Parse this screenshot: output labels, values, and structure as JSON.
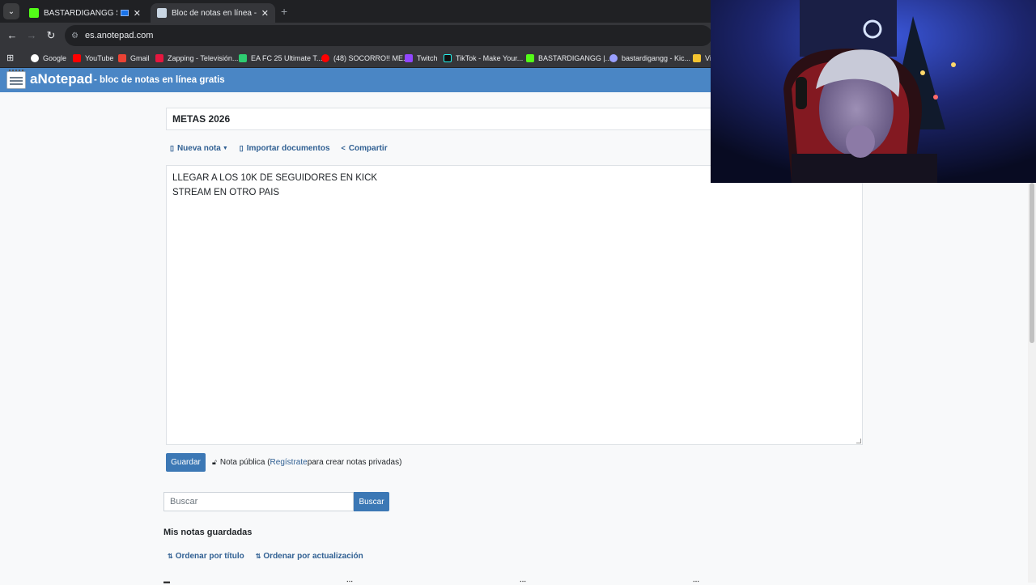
{
  "browser": {
    "tabs": [
      {
        "title": "BASTARDIGANGG Stream -",
        "active": false
      },
      {
        "title": "Bloc de notas en línea - Toma y",
        "active": true
      }
    ],
    "address": "es.anotepad.com",
    "bookmarks": [
      {
        "label": "Google"
      },
      {
        "label": "YouTube"
      },
      {
        "label": "Gmail"
      },
      {
        "label": "Zapping - Televisión..."
      },
      {
        "label": "EA FC 25 Ultimate T..."
      },
      {
        "label": "(48) SOCORRO!! ME..."
      },
      {
        "label": "Twitch"
      },
      {
        "label": "TikTok - Make Your..."
      },
      {
        "label": "BASTARDIGANGG |..."
      },
      {
        "label": "bastardigangg - Kic..."
      },
      {
        "label": "Vi"
      }
    ]
  },
  "site": {
    "brand": "aNotepad",
    "tagline": "- bloc de notas en línea gratis"
  },
  "note": {
    "title": "METAS 2026",
    "actions": {
      "new_note": "Nueva nota",
      "import": "Importar documentos",
      "share": "Compartir"
    },
    "lines": [
      "LLEGAR A LOS 10K DE SEGUIDORES EN KICK",
      "STREAM EN OTRO PAIS"
    ],
    "save_label": "Guardar",
    "visibility": {
      "prefix": "Nota pública (",
      "link": "Regístrate",
      "suffix": " para crear notas privadas)"
    }
  },
  "search": {
    "placeholder": "Buscar",
    "button": "Buscar"
  },
  "saved": {
    "heading": "Mis notas guardadas",
    "sort_title": "Ordenar por título",
    "sort_updated": "Ordenar por actualización"
  },
  "colors": {
    "header": "#4a86c5",
    "button": "#3c78b5",
    "link": "#2f5f92"
  }
}
